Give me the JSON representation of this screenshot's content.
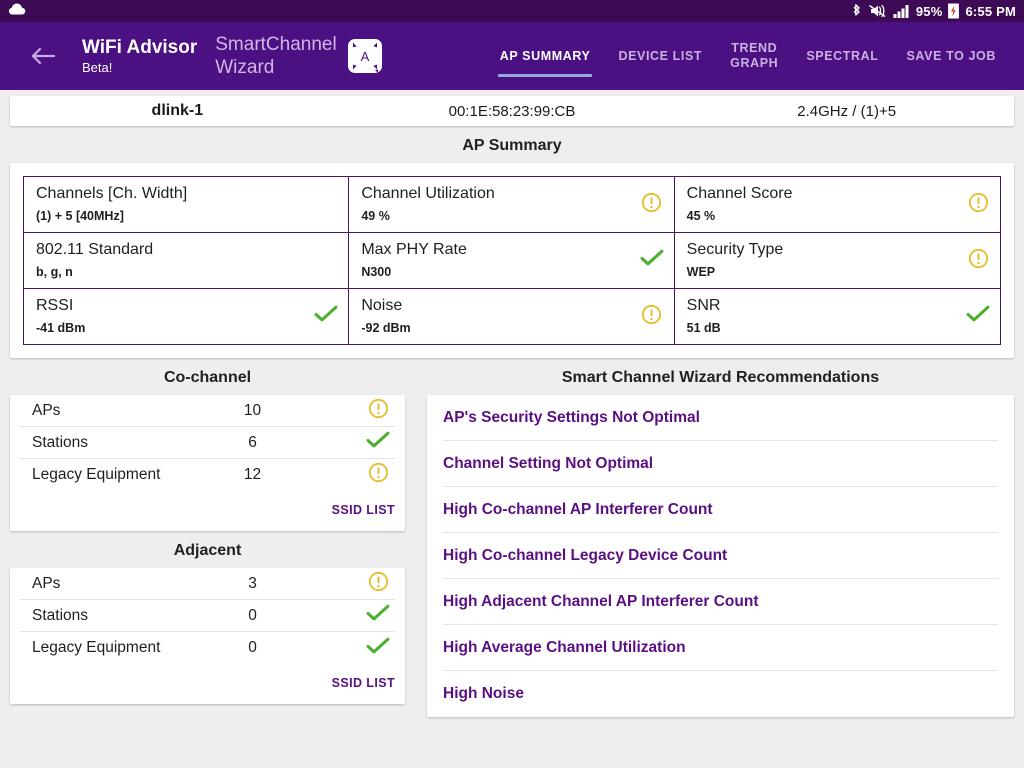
{
  "status_bar": {
    "left_icon": "cloud-icon",
    "icons": [
      "bluetooth-icon",
      "mute-vibrate-icon",
      "signal-bars-icon"
    ],
    "battery": "95%",
    "battery_icon": "battery-charging-icon",
    "time": "6:55 PM"
  },
  "app_bar": {
    "back_icon": "back-arrow-icon",
    "title": "WiFi Advisor",
    "subtitle": "Beta!",
    "wizard_name": "SmartChannel Wizard",
    "wizard_logo_letter": "A",
    "tabs": [
      {
        "label": "AP SUMMARY",
        "active": true
      },
      {
        "label": "DEVICE LIST",
        "active": false
      },
      {
        "label": "TREND\nGRAPH",
        "active": false
      },
      {
        "label": "SPECTRAL",
        "active": false
      },
      {
        "label": "SAVE TO JOB",
        "active": false
      }
    ]
  },
  "ap_info": {
    "ssid": "dlink-1",
    "bssid": "00:1E:58:23:99:CB",
    "band_channel": "2.4GHz / (1)+5"
  },
  "ap_summary": {
    "title": "AP Summary",
    "cells": [
      {
        "label": "Channels [Ch. Width]",
        "value": "(1) + 5 [40MHz]",
        "status": "none"
      },
      {
        "label": "Channel Utilization",
        "value": "49 %",
        "status": "warn"
      },
      {
        "label": "Channel Score",
        "value": "45 %",
        "status": "warn"
      },
      {
        "label": "802.11 Standard",
        "value": "b, g, n",
        "status": "none"
      },
      {
        "label": "Max PHY Rate",
        "value": "N300",
        "status": "ok"
      },
      {
        "label": "Security Type",
        "value": "WEP",
        "status": "warn"
      },
      {
        "label": "RSSI",
        "value": "-41 dBm",
        "status": "ok"
      },
      {
        "label": "Noise",
        "value": "-92 dBm",
        "status": "warn"
      },
      {
        "label": "SNR",
        "value": "51 dB",
        "status": "ok"
      }
    ]
  },
  "co_channel": {
    "title": "Co-channel",
    "rows": [
      {
        "label": "APs",
        "value": "10",
        "status": "warn"
      },
      {
        "label": "Stations",
        "value": "6",
        "status": "ok"
      },
      {
        "label": "Legacy Equipment",
        "value": "12",
        "status": "warn"
      }
    ],
    "link_label": "SSID LIST"
  },
  "adjacent": {
    "title": "Adjacent",
    "rows": [
      {
        "label": "APs",
        "value": "3",
        "status": "warn"
      },
      {
        "label": "Stations",
        "value": "0",
        "status": "ok"
      },
      {
        "label": "Legacy Equipment",
        "value": "0",
        "status": "ok"
      }
    ],
    "link_label": "SSID LIST"
  },
  "recommendations": {
    "title": "Smart Channel Wizard Recommendations",
    "items": [
      "AP's Security Settings Not Optimal",
      "Channel Setting Not Optimal",
      "High Co-channel AP Interferer Count",
      "High Co-channel Legacy Device Count",
      "High Adjacent Channel AP Interferer Count",
      "High Average Channel Utilization",
      "High Noise"
    ]
  },
  "colors": {
    "status_bar": "#3d0b56",
    "app_bar": "#4b1082",
    "accent_purple": "#5b1081",
    "tab_underline": "#93a9dd",
    "warn": "#e8bc29",
    "ok": "#4caf2f",
    "page_bg": "#eeeeee",
    "grid_border": "#4a1361"
  }
}
